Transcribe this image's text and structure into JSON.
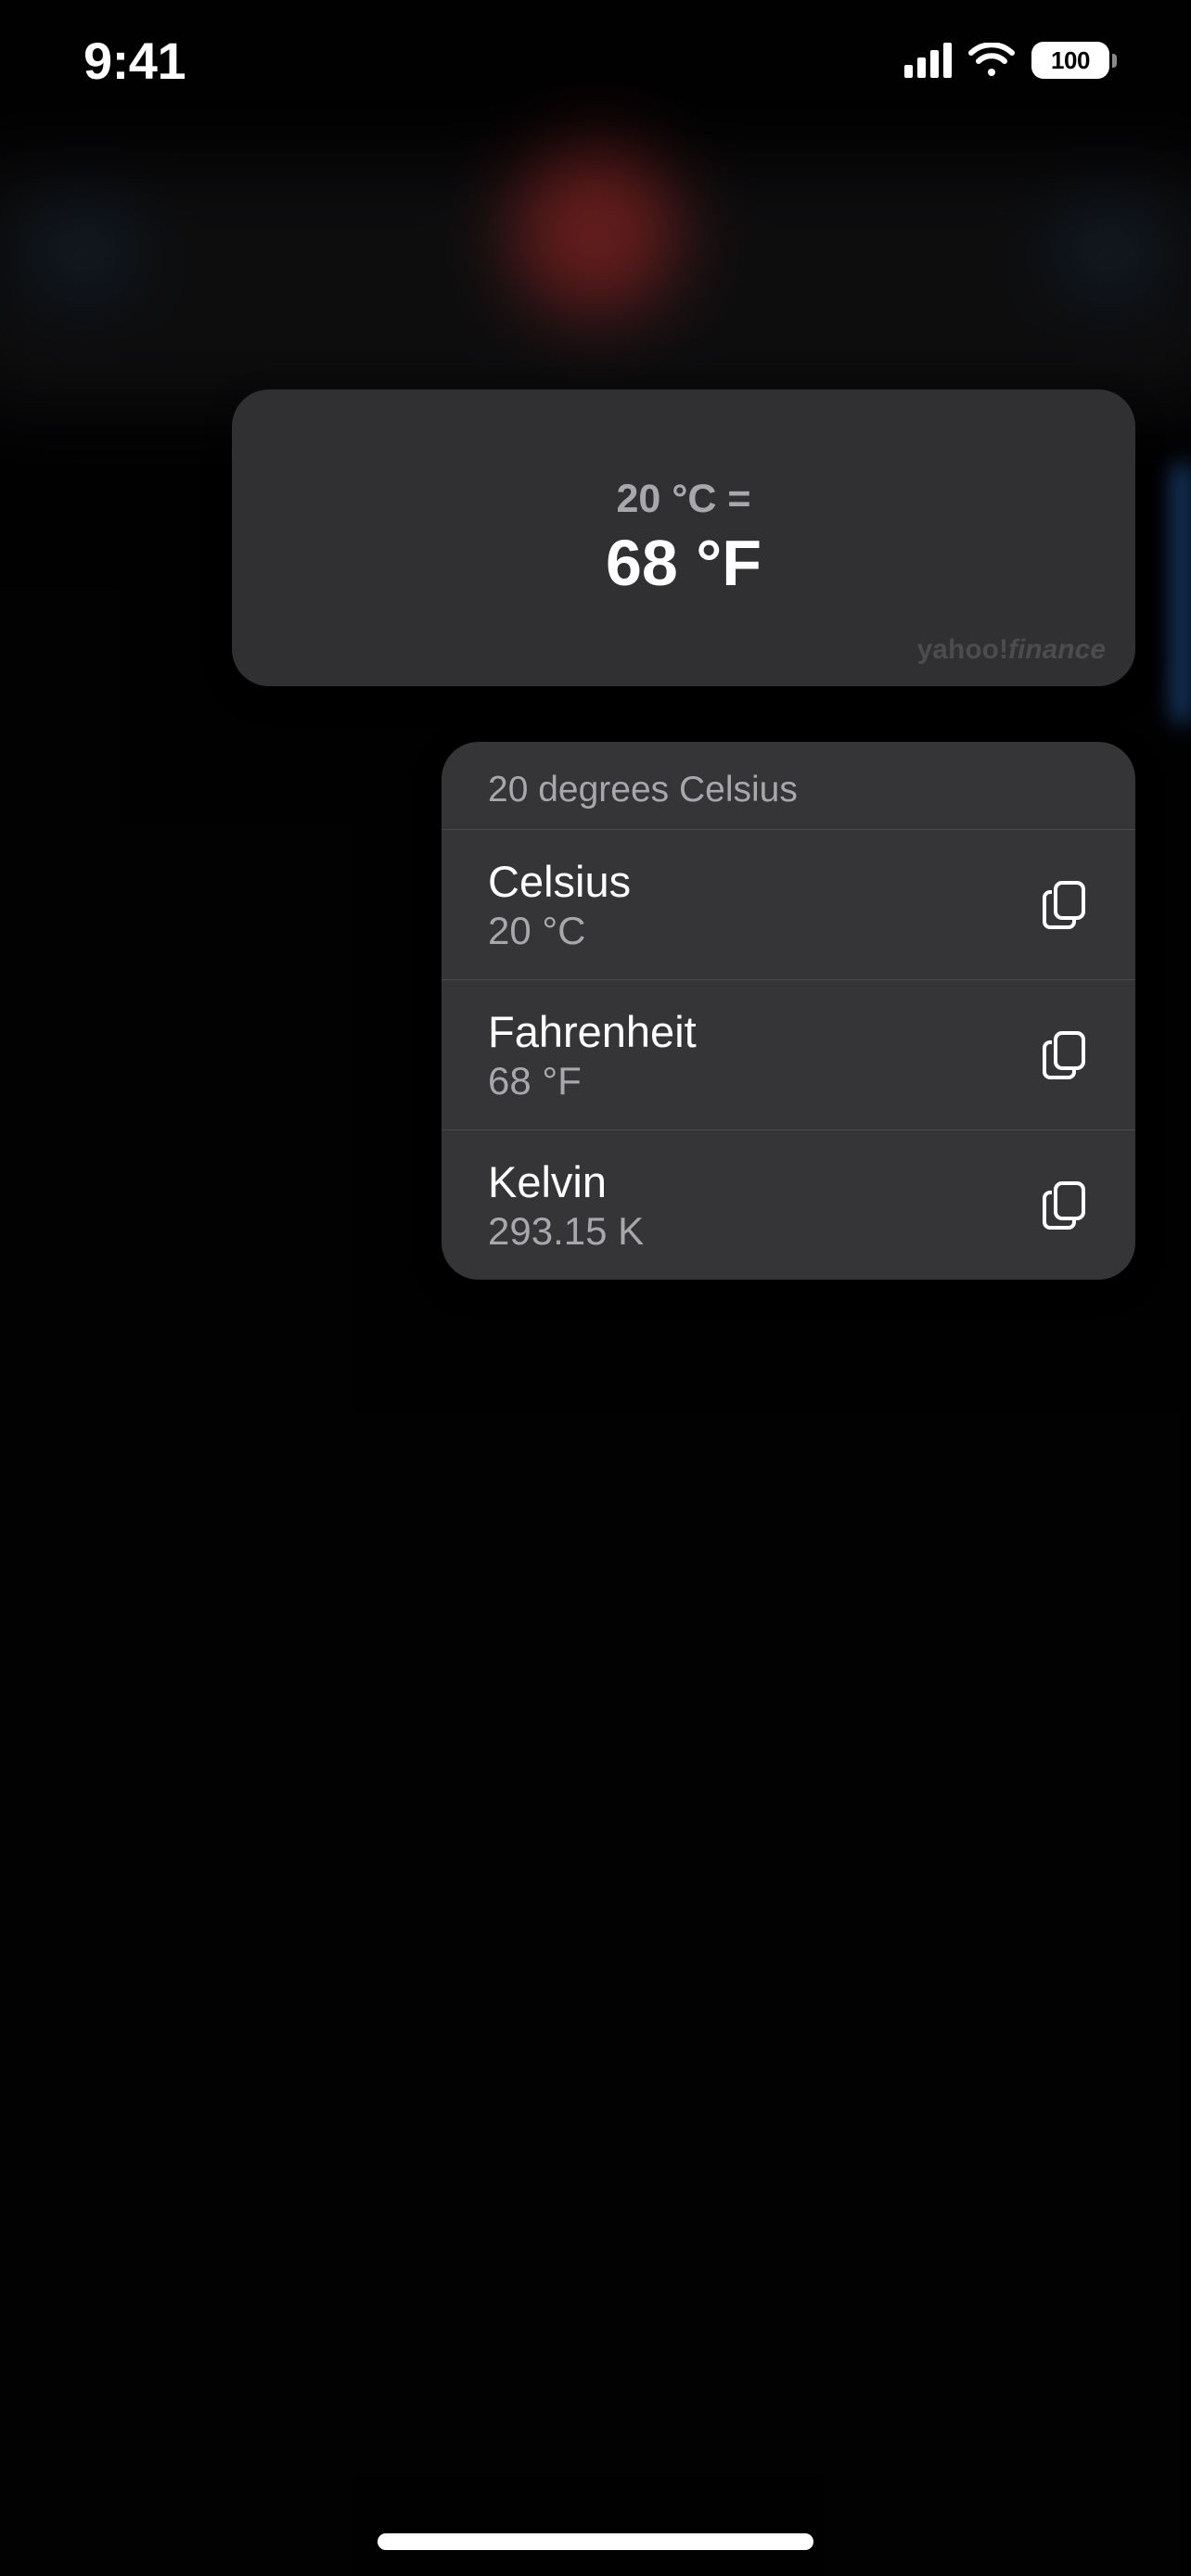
{
  "status_bar": {
    "time": "9:41",
    "battery": "100"
  },
  "answer_card": {
    "query": "20 °C =",
    "result": "68 °F",
    "source": "yahoo!",
    "source_suffix": "finance"
  },
  "conversions": {
    "header": "20 degrees Celsius",
    "items": [
      {
        "unit": "Celsius",
        "value": "20 °C"
      },
      {
        "unit": "Fahrenheit",
        "value": "68 °F"
      },
      {
        "unit": "Kelvin",
        "value": "293.15 K"
      }
    ]
  }
}
